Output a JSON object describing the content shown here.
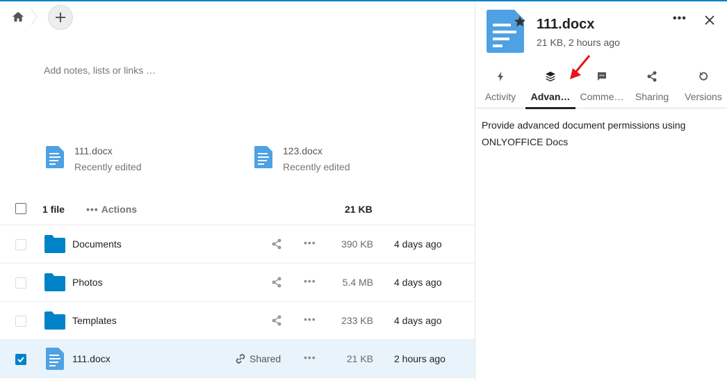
{
  "notes_placeholder": "Add notes, lists or links …",
  "recent": [
    {
      "name": "111.docx",
      "subtitle": "Recently edited"
    },
    {
      "name": "123.docx",
      "subtitle": "Recently edited"
    }
  ],
  "list_header": {
    "count": "1 file",
    "actions_dots": "•••",
    "actions": "Actions",
    "total_size": "21 KB"
  },
  "rows": [
    {
      "name": "Documents",
      "type": "folder",
      "size": "390 KB",
      "date": "4 days ago",
      "more": "•••"
    },
    {
      "name": "Photos",
      "type": "folder",
      "size": "5.4 MB",
      "date": "4 days ago",
      "more": "•••"
    },
    {
      "name": "Templates",
      "type": "folder",
      "size": "233 KB",
      "date": "4 days ago",
      "more": "•••"
    },
    {
      "name": "111.docx",
      "type": "docx",
      "size": "21 KB",
      "date": "2 hours ago",
      "more": "•••",
      "shared_label": "Shared",
      "selected": true
    }
  ],
  "sidebar": {
    "title": "111.docx",
    "subtitle": "21 KB, 2 hours ago",
    "more": "•••",
    "tabs": [
      {
        "label": "Activity",
        "icon": "lightning-icon"
      },
      {
        "label": "Advan…",
        "icon": "layers-icon",
        "active": true
      },
      {
        "label": "Comme…",
        "icon": "comment-icon"
      },
      {
        "label": "Sharing",
        "icon": "share-icon"
      },
      {
        "label": "Versions",
        "icon": "history-icon"
      }
    ],
    "content": "Provide advanced document permissions using ONLYOFFICE Docs"
  },
  "colors": {
    "accent": "#0082c9",
    "folder": "#0082c9",
    "doc": "#4ea1e3",
    "selected_row": "#e8f3fb",
    "annotation_arrow": "#e8141a"
  }
}
